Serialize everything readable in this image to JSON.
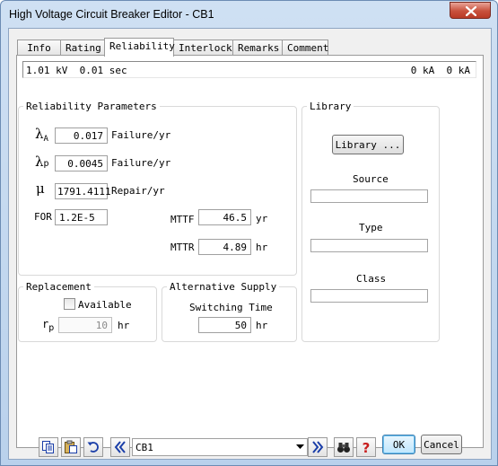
{
  "window": {
    "title": "High Voltage Circuit Breaker Editor - CB1"
  },
  "tabs": [
    "Info",
    "Rating",
    "Reliability",
    "Interlock",
    "Remarks",
    "Comment"
  ],
  "status": {
    "left": "1.01 kV  0.01 sec",
    "right": "0 kA  0 kA"
  },
  "reliability": {
    "legend": "Reliability Parameters",
    "lambda_a": {
      "symbol": "λ",
      "sub": "A",
      "value": "0.017",
      "unit": "Failure/yr"
    },
    "lambda_p": {
      "symbol": "λ",
      "sub": "p",
      "value": "0.0045",
      "unit": "Failure/yr"
    },
    "mu": {
      "symbol": "μ",
      "value": "1791.4111",
      "unit": "Repair/yr"
    },
    "for": {
      "label": "FOR",
      "value": "1.2E-5"
    },
    "mttf": {
      "label": "MTTF",
      "value": "46.5",
      "unit": "yr"
    },
    "mttr": {
      "label": "MTTR",
      "value": "4.89",
      "unit": "hr"
    }
  },
  "replacement": {
    "legend": "Replacement",
    "available_label": "Available",
    "available_checked": false,
    "rp_symbol": "r",
    "rp_sub": "p",
    "rp_value": "10",
    "rp_unit": "hr"
  },
  "alt_supply": {
    "legend": "Alternative Supply",
    "switching_label": "Switching Time",
    "switching_value": "50",
    "switching_unit": "hr"
  },
  "library": {
    "legend": "Library",
    "button_label": "Library ...",
    "source_label": "Source",
    "source_value": "",
    "type_label": "Type",
    "type_value": "",
    "class_label": "Class",
    "class_value": ""
  },
  "bottom": {
    "selector_value": "CB1",
    "ok_label": "OK",
    "cancel_label": "Cancel"
  },
  "colors": {
    "accent_blue": "#1a3ea8",
    "help_red": "#c81e1e",
    "tab_active": "#ffffff"
  }
}
